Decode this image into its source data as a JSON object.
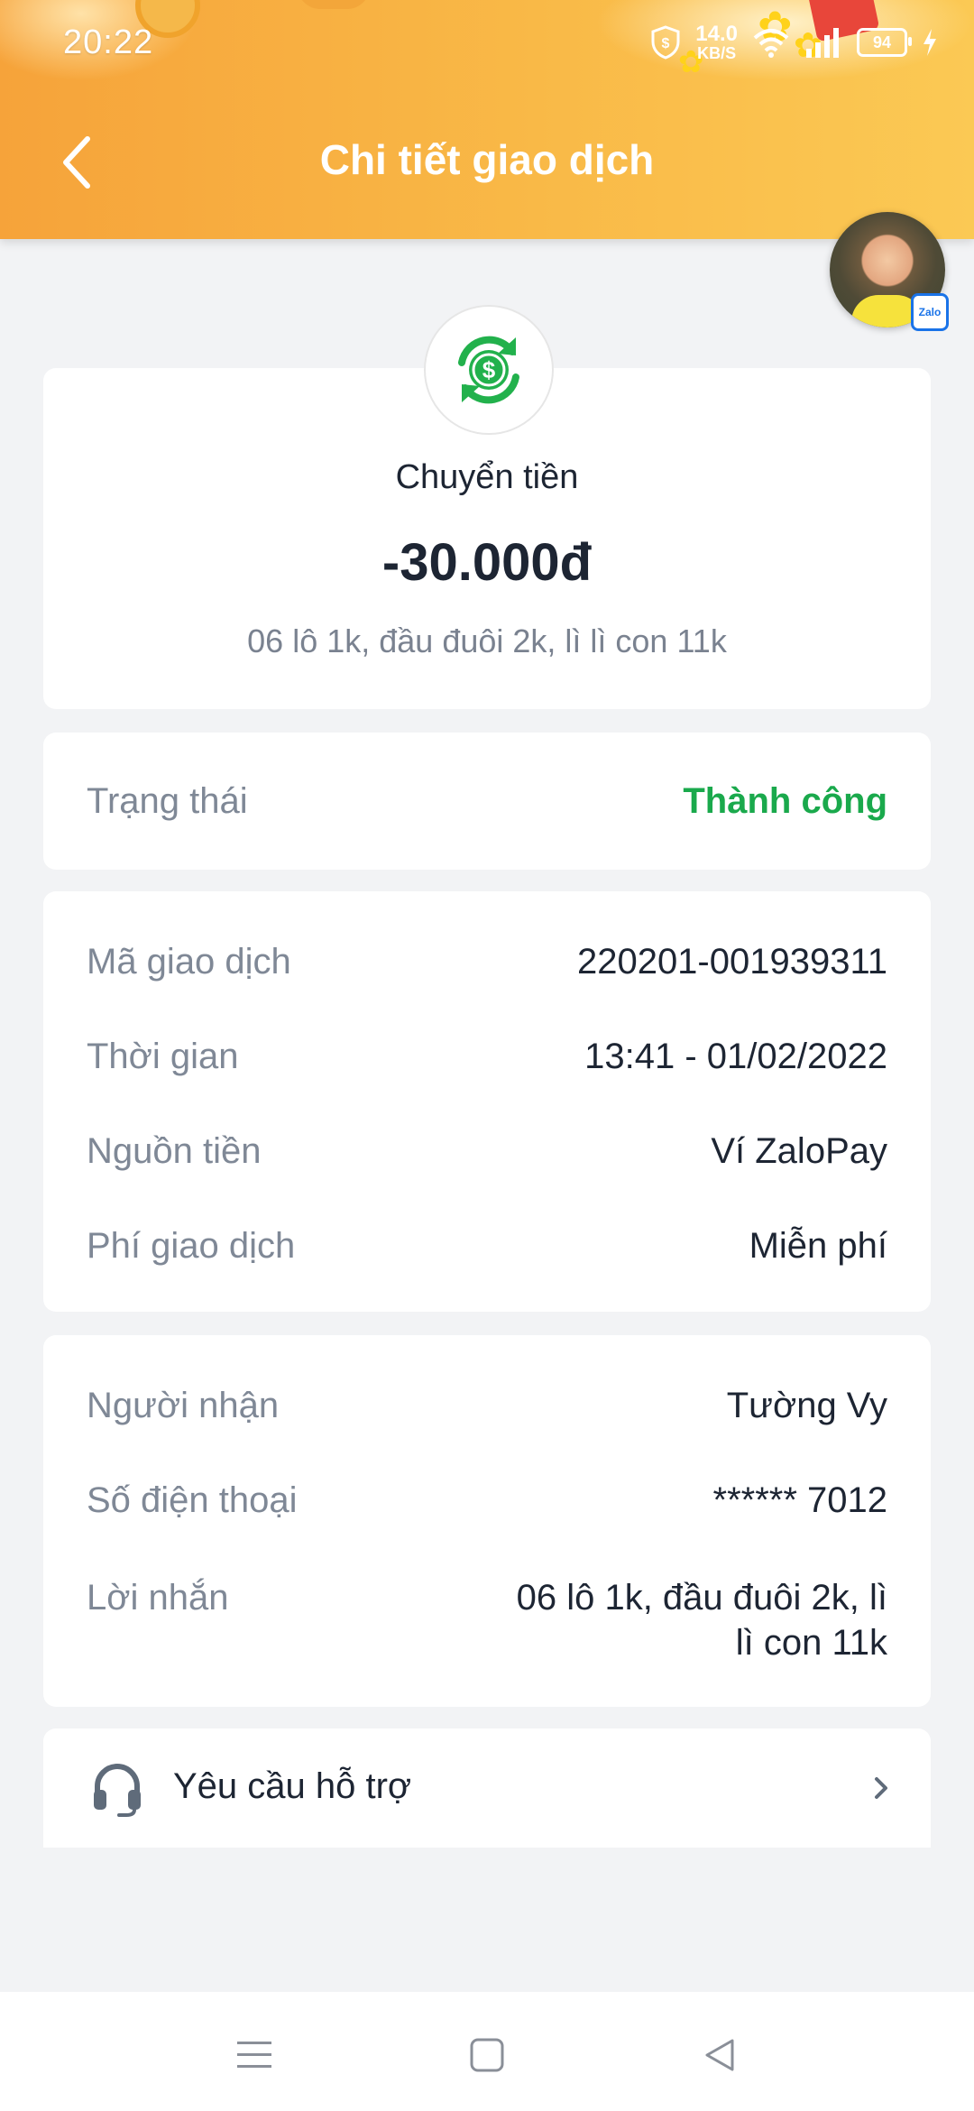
{
  "status_bar": {
    "time": "20:22",
    "net_speed_value": "14.0",
    "net_speed_unit": "KB/S",
    "battery": "94"
  },
  "header": {
    "title": "Chi tiết giao dịch"
  },
  "summary": {
    "type_label": "Chuyển tiền",
    "amount": "-30.000đ",
    "note": "06 lô 1k, đầu đuôi 2k, lì lì con 11k"
  },
  "status": {
    "label": "Trạng thái",
    "value": "Thành công",
    "value_color": "#1aa94c"
  },
  "details": [
    {
      "label": "Mã giao dịch",
      "value": "220201-001939311"
    },
    {
      "label": "Thời gian",
      "value": "13:41 - 01/02/2022"
    },
    {
      "label": "Nguồn tiền",
      "value": "Ví ZaloPay"
    },
    {
      "label": "Phí giao dịch",
      "value": "Miễn phí"
    }
  ],
  "recipient": [
    {
      "label": "Người nhận",
      "value": "Tường Vy"
    },
    {
      "label": "Số điện thoại",
      "value": "****** 7012"
    },
    {
      "label": "Lời nhắn",
      "value_line1": "06 lô 1k, đầu đuôi 2k, lì",
      "value_line2": "lì con 11k"
    }
  ],
  "support": {
    "label": "Yêu cầu hỗ trợ"
  },
  "floating_chat": {
    "badge": "Zalo"
  },
  "colors": {
    "header_gradient_start": "#f6a33a",
    "header_gradient_end": "#fbc954",
    "success_green": "#1aa94c",
    "icon_green": "#22b14c"
  }
}
